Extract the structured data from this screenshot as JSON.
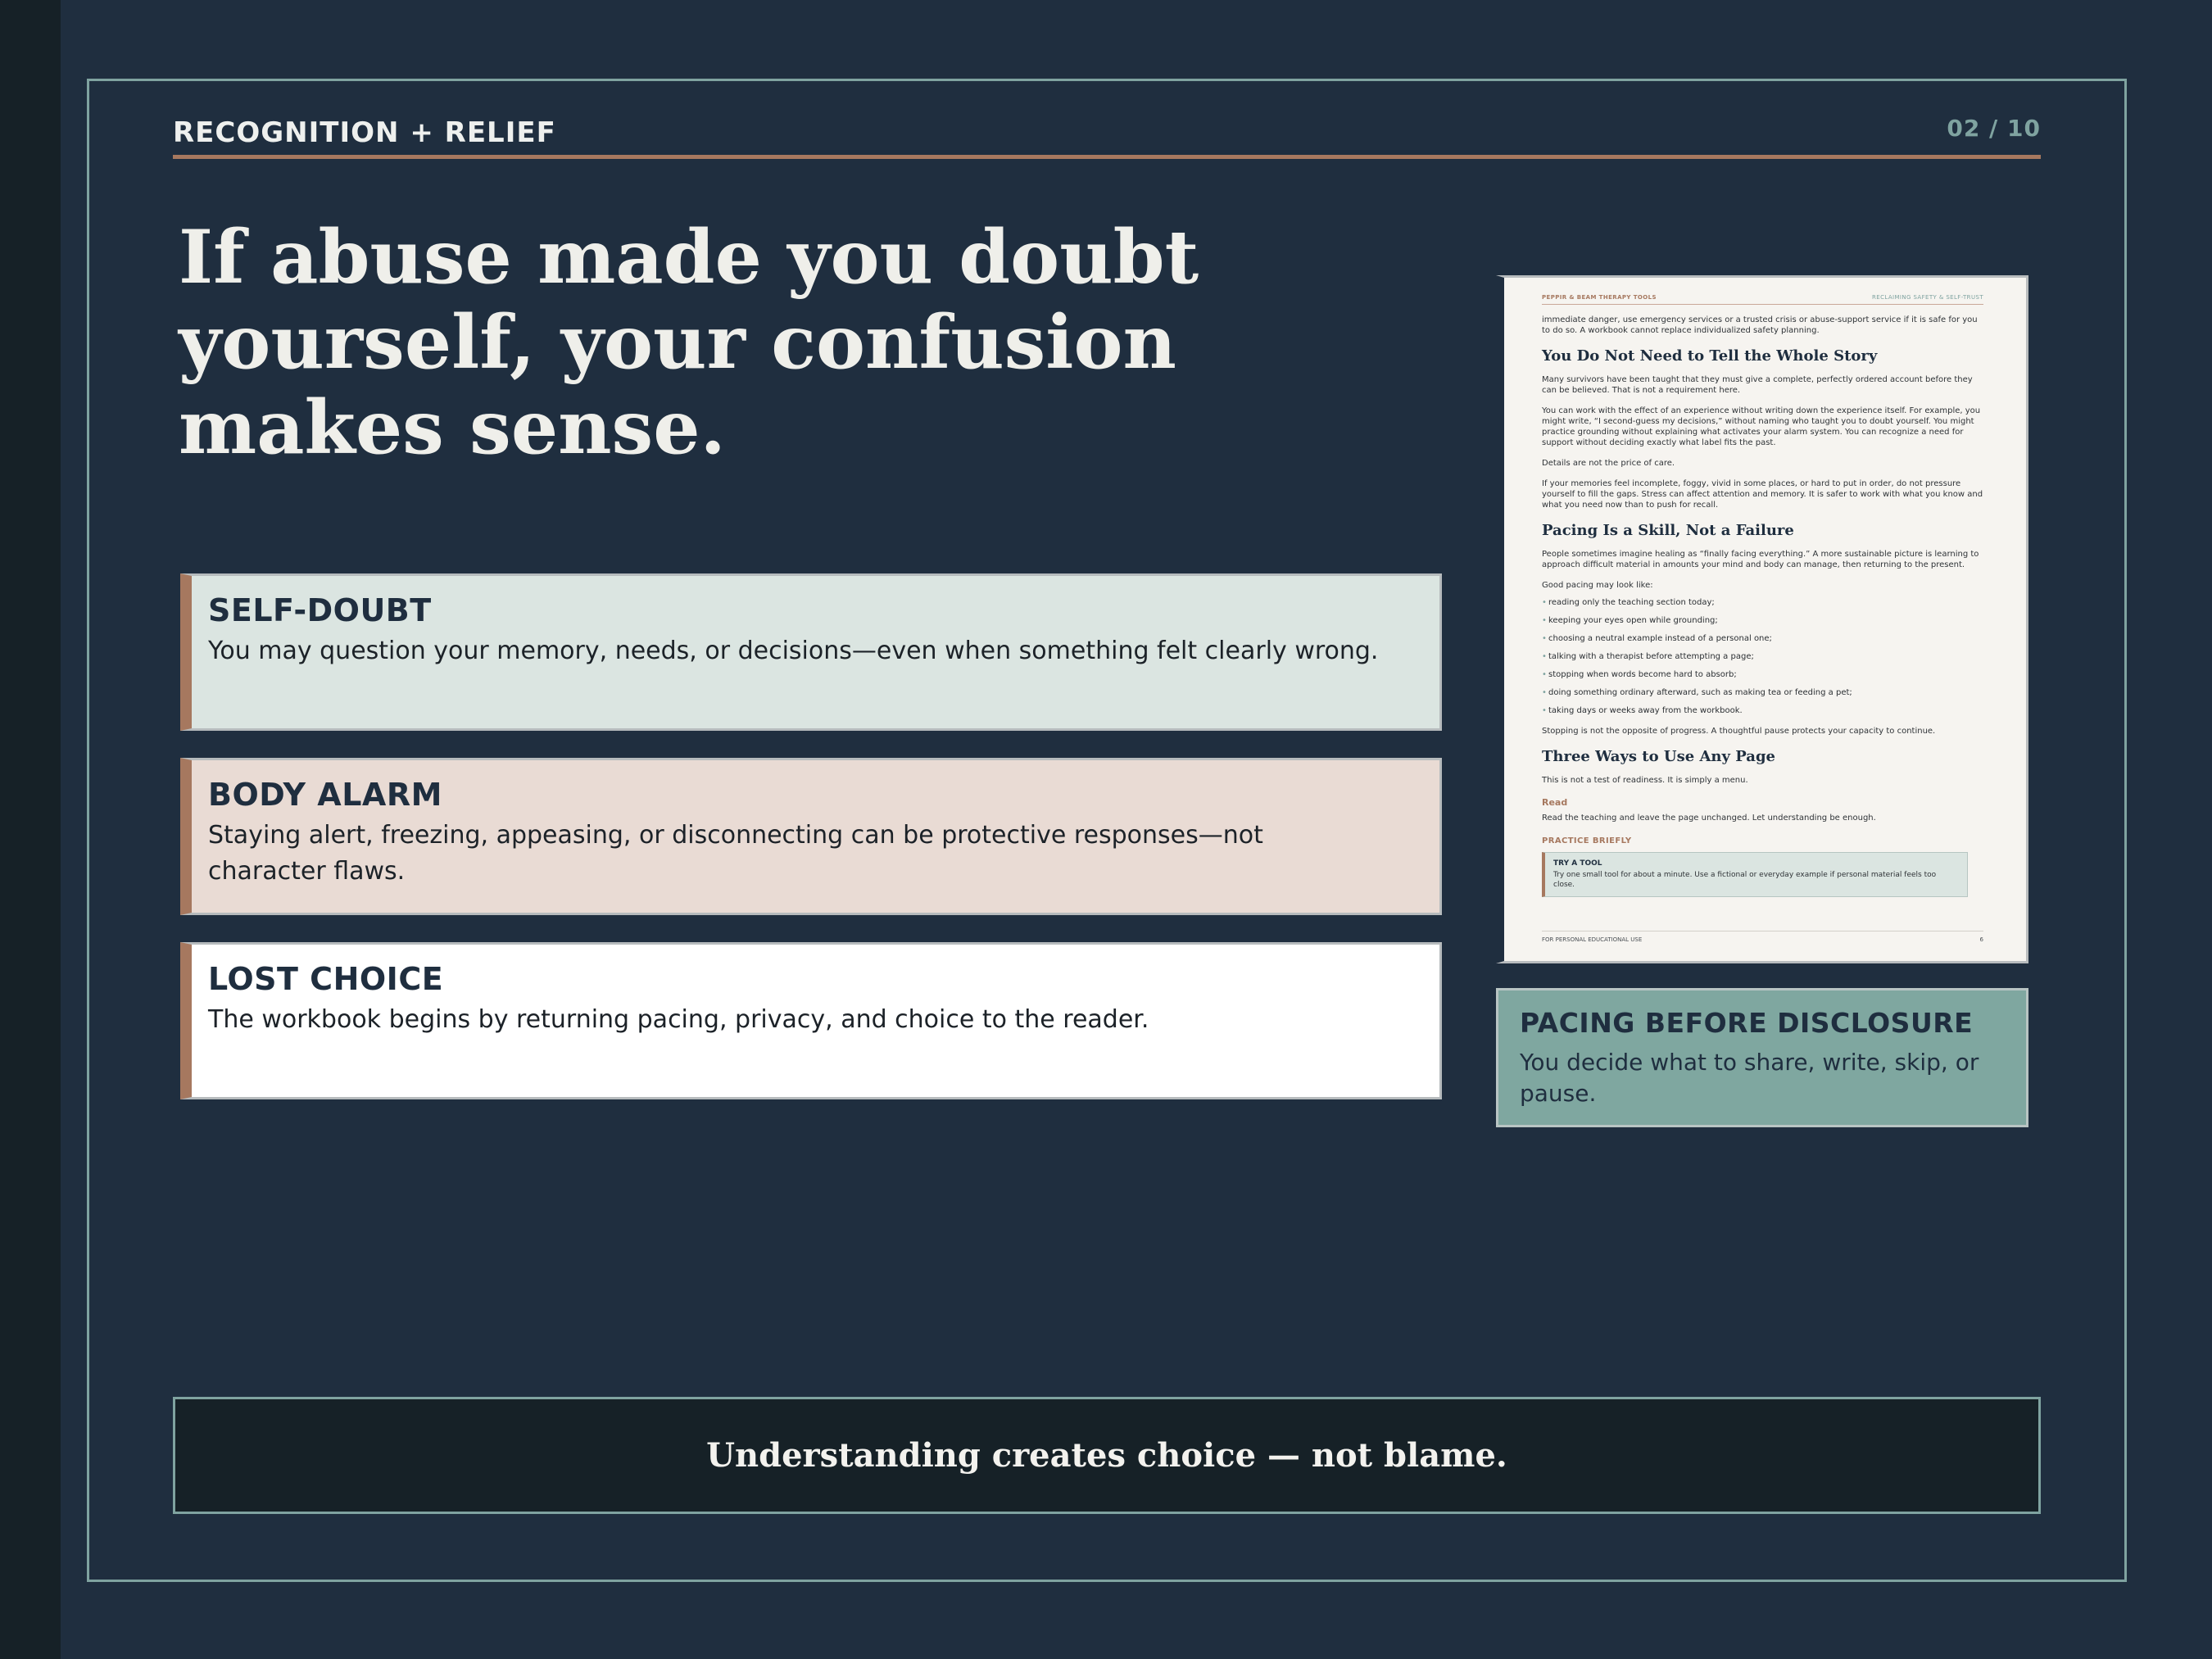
{
  "header": {
    "section": "RECOGNITION + RELIEF",
    "page": "02 / 10"
  },
  "headline": "If abuse made you doubt yourself, your confusion makes sense.",
  "cards": [
    {
      "title": "SELF-DOUBT",
      "body": "You may question your memory, needs, or decisions—even when something felt clearly wrong."
    },
    {
      "title": "BODY ALARM",
      "body": "Staying alert, freezing, appeasing, or disconnecting can be protective responses—not character flaws."
    },
    {
      "title": "LOST CHOICE",
      "body": "The workbook begins by returning pacing, privacy, and choice to the reader."
    }
  ],
  "doc": {
    "brand": "PEPPIR & BEAM THERAPY TOOLS",
    "series": "RECLAIMING SAFETY & SELF-TRUST",
    "intro": "immediate danger, use emergency services or a trusted crisis or abuse-support service if it is safe for you to do so. A workbook cannot replace individualized safety planning.",
    "h1": "You Do Not Need to Tell the Whole Story",
    "p1": "Many survivors have been taught that they must give a complete, perfectly ordered account before they can be believed. That is not a requirement here.",
    "p2": "You can work with the effect of an experience without writing down the experience itself. For example, you might write, “I second-guess my decisions,” without naming who taught you to doubt yourself. You might practice grounding without explaining what activates your alarm system. You can recognize a need for support without deciding exactly what label fits the past.",
    "p3": "Details are not the price of care.",
    "p4": "If your memories feel incomplete, foggy, vivid in some places, or hard to put in order, do not pressure yourself to fill the gaps. Stress can affect attention and memory. It is safer to work with what you know and what you need now than to push for recall.",
    "h2": "Pacing Is a Skill, Not a Failure",
    "p5": "People sometimes imagine healing as “finally facing everything.” A more sustainable picture is learning to approach difficult material in amounts your mind and body can manage, then returning to the present.",
    "p6": "Good pacing may look like:",
    "bullets": [
      "reading only the teaching section today;",
      "keeping your eyes open while grounding;",
      "choosing a neutral example instead of a personal one;",
      "talking with a therapist before attempting a page;",
      "stopping when words become hard to absorb;",
      "doing something ordinary afterward, such as making tea or feeding a pet;",
      "taking days or weeks away from the workbook."
    ],
    "p7": "Stopping is not the opposite of progress. A thoughtful pause protects your capacity to continue.",
    "h3": "Three Ways to Use Any Page",
    "p8": "This is not a test of readiness. It is simply a menu.",
    "sub1": "Read",
    "p9": "Read the teaching and leave the page unchanged. Let understanding be enough.",
    "practice": "PRACTICE BRIEFLY",
    "tool_title": "TRY A TOOL",
    "tool_body": "Try one small tool for about a minute. Use a fictional or everyday example if personal material feels too close.",
    "footer_left": "FOR PERSONAL EDUCATIONAL USE",
    "footer_right": "6"
  },
  "pacing": {
    "title": "PACING BEFORE DISCLOSURE",
    "body": "You decide what to share, write, skip, or pause."
  },
  "bottom": "Understanding creates choice — not blame.",
  "colors": {
    "background": "#1f2e3f",
    "accent": "#a6785f",
    "teal": "#7fa3a0"
  }
}
